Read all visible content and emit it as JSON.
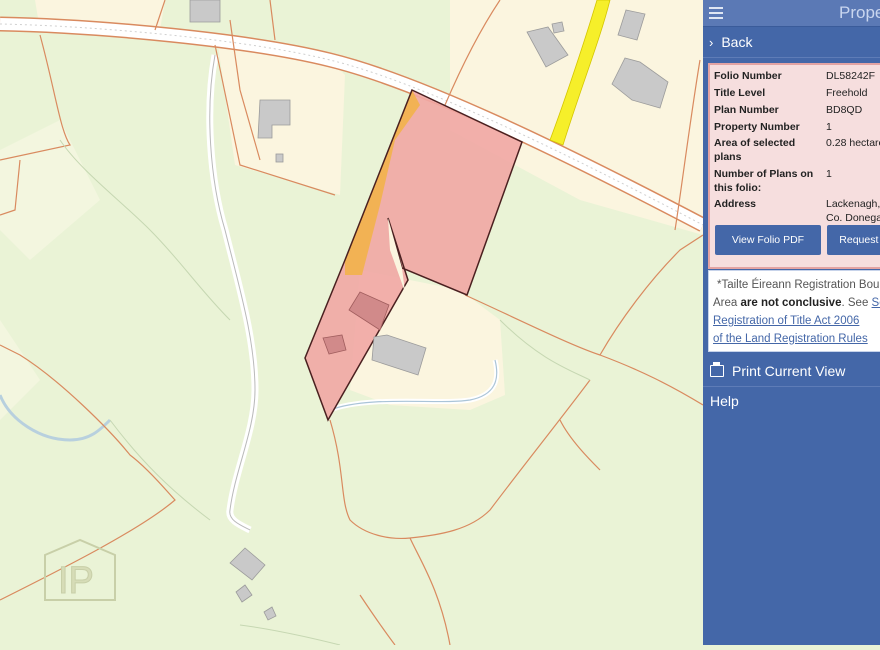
{
  "panel": {
    "title": "Prope",
    "back_label": "Back",
    "info": {
      "rows": [
        {
          "key": "Folio Number",
          "value": "DL58242F"
        },
        {
          "key": "Title Level",
          "value": "Freehold"
        },
        {
          "key": "Plan Number",
          "value": "BD8QD"
        },
        {
          "key": "Property Number",
          "value": "1"
        },
        {
          "key": "Area of selected plans",
          "value": "0.28 hectare"
        },
        {
          "key": "Number of Plans on this folio:",
          "value": "1"
        },
        {
          "key": "Address",
          "value": "Lackenagh, Co. Donegal"
        }
      ]
    },
    "buttons": {
      "view_pdf": "View Folio PDF",
      "request": "Request Co"
    },
    "notice": {
      "line1": "*Tailte Éireann Registration Bound",
      "line2_prefix": "Area ",
      "line2_bold": "are not conclusive",
      "line2_suffix": ". See ",
      "line2_link": "Sec",
      "line3_link": "Registration of Title Act 2006",
      "line4_link": "of the Land Registration Rules"
    },
    "print_label": "Print Current View",
    "help_label": "Help"
  },
  "map": {
    "watermark": "IP",
    "colors": {
      "field": "#eaf3d6",
      "plot": "#fbf5df",
      "road": "#ffffff",
      "boundary": "#d98a5f",
      "selected_fill": "#f1a7a4",
      "orange_strip": "#f2b24a",
      "yellow_strip": "#f6ef2a",
      "building": "#c9c9c9"
    }
  }
}
